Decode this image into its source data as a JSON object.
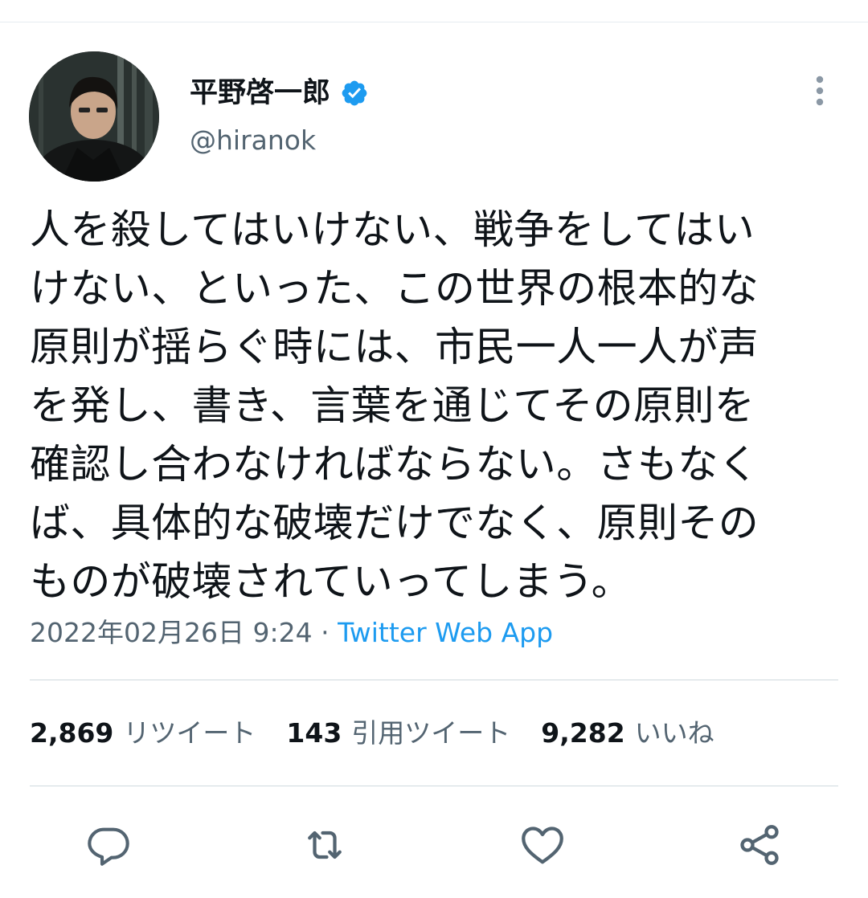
{
  "tweet": {
    "author": {
      "display_name": "平野啓一郎",
      "handle": "@hiranok",
      "verified": true
    },
    "text": "人を殺してはいけない、戦争をしてはい\nけない、といった、この世界の根本的な\n原則が揺らぐ時には、市民一人一人が声\nを発し、書き、言葉を通じてその原則を\n確認し合わなければならない。さもなく\nば、具体的な破壊だけでなく、原則その\nものが破壊されていってしまう。",
    "timestamp": "2022年02月26日 9:24",
    "separator": "·",
    "source": "Twitter Web App",
    "stats": {
      "retweets": "2,869",
      "retweets_label": "リツイート",
      "quotes": "143",
      "quotes_label": "引用ツイート",
      "likes": "9,282",
      "likes_label": "いいね"
    }
  },
  "icons": {
    "more": "more-vertical-icon",
    "verified": "verified-badge-icon",
    "reply": "reply-icon",
    "retweet": "retweet-icon",
    "like": "heart-icon",
    "share": "share-icon"
  },
  "colors": {
    "accent": "#1d9bf0",
    "secondary_text": "#536471",
    "primary_text": "#0f1419",
    "divider": "#cfd9de"
  }
}
